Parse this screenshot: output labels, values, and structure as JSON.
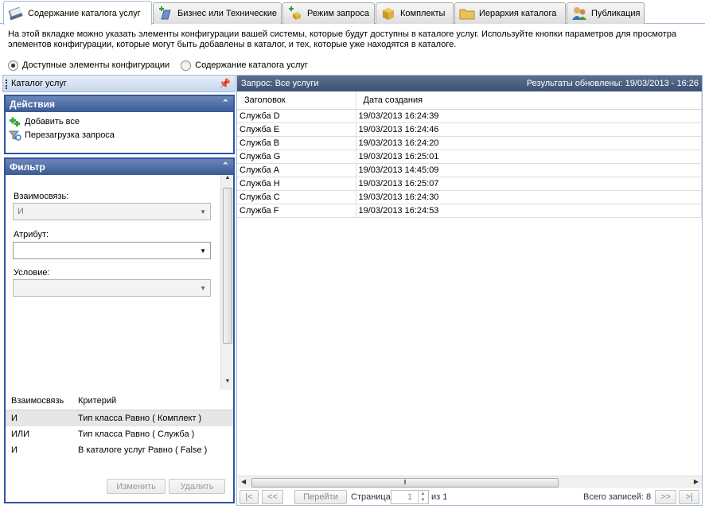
{
  "tabs": [
    {
      "label": "Содержание каталога услуг",
      "icon": "book-icon",
      "active": true
    },
    {
      "label": "Бизнес или Технические",
      "icon": "service-add-icon",
      "active": false
    },
    {
      "label": "Режим запроса",
      "icon": "query-icon",
      "active": false
    },
    {
      "label": "Комплекты",
      "icon": "package-icon",
      "active": false
    },
    {
      "label": "Иерархия каталога",
      "icon": "folder-icon",
      "active": false
    },
    {
      "label": "Публикация",
      "icon": "users-icon",
      "active": false
    }
  ],
  "description": "На этой вкладке можно указать элементы конфигурации вашей системы, которые будут доступны в каталоге услуг. Используйте кнопки параметров для просмотра элементов конфигурации, которые могут быть добавлены в каталог, и тех, которые уже находятся в каталоге.",
  "view_options": {
    "option1": "Доступные элементы конфигурации",
    "option2": "Содержание каталога услуг",
    "selected": "option1"
  },
  "left_panel": {
    "title": "Каталог услуг",
    "actions": {
      "title": "Действия",
      "items": [
        "Добавить все",
        "Перезагрузка запроса"
      ]
    },
    "filter": {
      "title": "Фильтр",
      "relation_label": "Взаимосвязь:",
      "relation_value": "И",
      "attribute_label": "Атрибут:",
      "attribute_value": "",
      "condition_label": "Условие:",
      "condition_value": "",
      "criteria_headers": [
        "Взаимосвязь",
        "Критерий"
      ],
      "criteria_rows": [
        {
          "relation": "И",
          "criterion": "Тип класса Равно ( Комплект )"
        },
        {
          "relation": "ИЛИ",
          "criterion": "Тип класса Равно ( Служба )"
        },
        {
          "relation": "И",
          "criterion": "В каталоге услуг Равно ( False )"
        }
      ],
      "edit_button": "Изменить",
      "delete_button": "Удалить"
    }
  },
  "right_panel": {
    "query_title": "Запрос: Все услуги",
    "updated_text": "Результаты обновлены: 19/03/2013 - 16:26",
    "columns": [
      "Заголовок",
      "Дата создания"
    ],
    "rows": [
      [
        "Служба D",
        "19/03/2013 16:24:39"
      ],
      [
        "Служба E",
        "19/03/2013 16:24:46"
      ],
      [
        "Служба B",
        "19/03/2013 16:24:20"
      ],
      [
        "Служба G",
        "19/03/2013 16:25:01"
      ],
      [
        "Служба A",
        "19/03/2013 14:45:09"
      ],
      [
        "Служба H",
        "19/03/2013 16:25:07"
      ],
      [
        "Служба C",
        "19/03/2013 16:24:30"
      ],
      [
        "Служба F",
        "19/03/2013 16:24:53"
      ]
    ],
    "pager": {
      "first": "|<",
      "prev": "<<",
      "go": "Перейти",
      "page_label": "Страница",
      "page_value": "1",
      "of_label": "из 1",
      "total_label": "Всего записей: 8",
      "next": ">>",
      "last": ">|"
    }
  }
}
